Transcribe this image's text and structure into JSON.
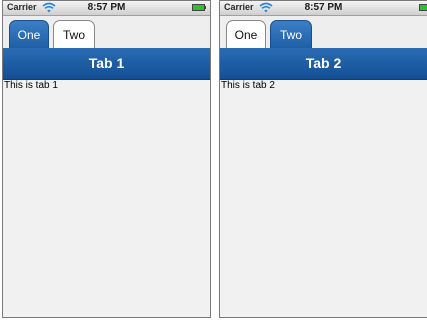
{
  "screens": [
    {
      "status": {
        "carrier": "Carrier",
        "time": "8:57 PM"
      },
      "tabs": [
        {
          "label": "One",
          "active": true
        },
        {
          "label": "Two",
          "active": false
        }
      ],
      "nav_title": "Tab 1",
      "content_text": "This is tab 1"
    },
    {
      "status": {
        "carrier": "Carrier",
        "time": "8:57 PM"
      },
      "tabs": [
        {
          "label": "One",
          "active": false
        },
        {
          "label": "Two",
          "active": true
        }
      ],
      "nav_title": "Tab 2",
      "content_text": "This is tab 2"
    }
  ],
  "colors": {
    "nav_bar": "#1f5fa6",
    "active_tab": "#2a6cb4",
    "inactive_tab": "#ffffff",
    "battery": "#2fbf2f",
    "wifi": "#2a86d8",
    "background": "#f1f1f1"
  },
  "icons": {
    "signal": "wifi-icon",
    "battery": "battery-icon"
  }
}
